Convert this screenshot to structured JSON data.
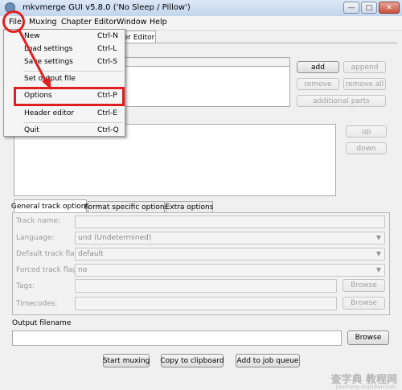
{
  "window": {
    "title": "mkvmerge GUI v5.8.0 ('No Sleep / Pillow')",
    "controls": {
      "minimize": "—",
      "maximize": "□",
      "close": "✕"
    }
  },
  "menubar": [
    "File",
    "Muxing",
    "Chapter Editor",
    "Window",
    "Help"
  ],
  "file_menu": [
    {
      "label": "New",
      "shortcut": "Ctrl-N"
    },
    {
      "label": "Load settings",
      "shortcut": "Ctrl-L"
    },
    {
      "label": "Save settings",
      "shortcut": "Ctrl-S"
    },
    {
      "label": "Set output file",
      "shortcut": ""
    },
    {
      "label": "Options",
      "shortcut": "Ctrl-P"
    },
    {
      "label": "Header editor",
      "shortcut": "Ctrl-E"
    },
    {
      "label": "Quit",
      "shortcut": "Ctrl-Q"
    }
  ],
  "main_tabs": {
    "partial_label": "er Editor"
  },
  "input_buttons": {
    "add": "add",
    "append": "append",
    "remove": "remove",
    "remove_all": "remove all",
    "additional_parts": "additional parts"
  },
  "track_buttons": {
    "up": "up",
    "down": "down"
  },
  "track_tabs": [
    "General track options",
    "Format specific options",
    "Extra options"
  ],
  "track_options": {
    "track_name": {
      "label": "Track name:",
      "value": ""
    },
    "language": {
      "label": "Language:",
      "value": "und (Undetermined)"
    },
    "default_track_flag": {
      "label": "Default track flag:",
      "value": "default"
    },
    "forced_track_flag": {
      "label": "Forced track flag:",
      "value": "no"
    },
    "tags": {
      "label": "Tags:",
      "value": "",
      "button": "Browse"
    },
    "timecodes": {
      "label": "Timecodes:",
      "value": "",
      "button": "Browse"
    }
  },
  "output": {
    "label": "Output filename",
    "value": "",
    "browse": "Browse"
  },
  "actions": {
    "start_muxing": "Start muxing",
    "copy_to_clipboard": "Copy to clipboard",
    "add_to_job_queue": "Add to job queue"
  },
  "watermark": {
    "text": "查字典 教程网",
    "url": "jiaocheng.chazidian.com"
  },
  "colors": {
    "annotation": "#e02020",
    "title_bar": "#c3d6ee"
  }
}
